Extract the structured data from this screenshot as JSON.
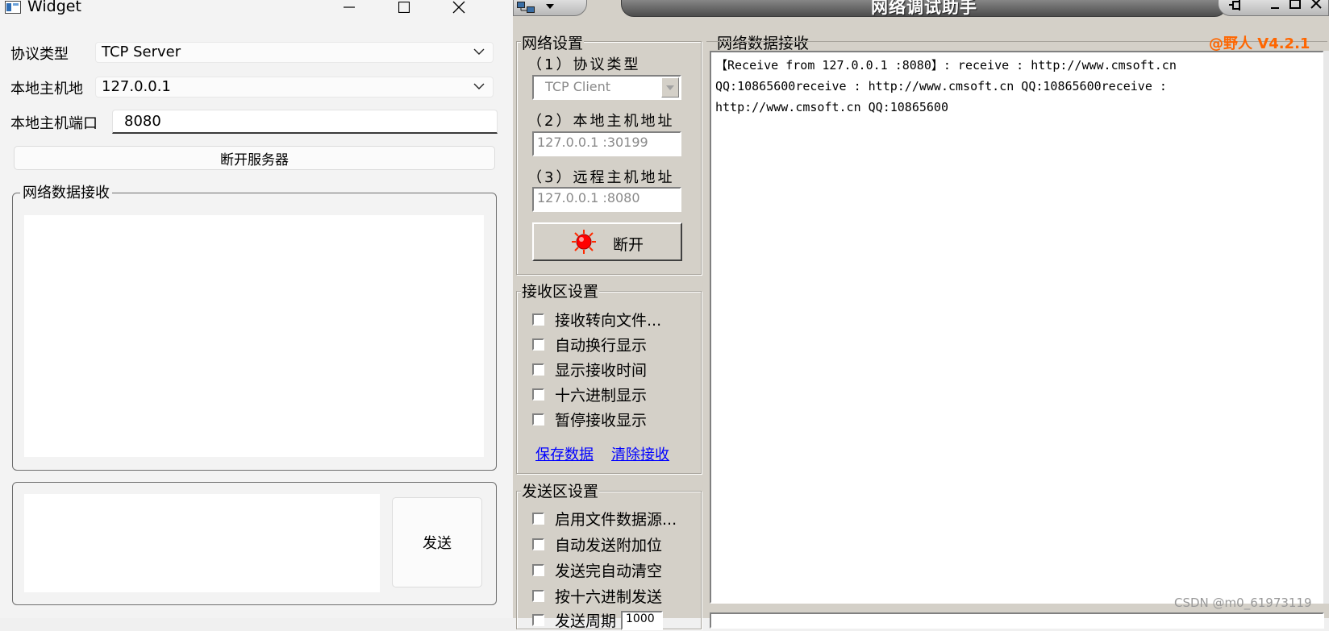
{
  "qt_window": {
    "title": "Widget",
    "protocol_label": "协议类型",
    "protocol_value": "TCP Server",
    "host_label": "本地主机地",
    "host_value": "127.0.0.1",
    "port_label": "本地主机端口",
    "port_value": "8080",
    "disconnect_label": "断开服务器",
    "recv_group_title": "网络数据接收",
    "send_label": "发送"
  },
  "netassist": {
    "title": "网络调试助手",
    "version": "@野人 V4.2.1",
    "net_settings_title": "网络设置",
    "protocol_caption": "（1）协议类型",
    "protocol_value": "TCP Client",
    "local_caption": "（2）本地主机地址",
    "local_value": "127.0.0.1 :30199",
    "remote_caption": "（3）远程主机地址",
    "remote_value": "127.0.0.1 :8080",
    "disconnect_label": "断开",
    "recv_settings_title": "接收区设置",
    "recv_options": [
      "接收转向文件...",
      "自动换行显示",
      "显示接收时间",
      "十六进制显示",
      "暂停接收显示"
    ],
    "save_link": "保存数据",
    "clear_link": "清除接收",
    "send_settings_title": "发送区设置",
    "send_options": [
      "启用文件数据源...",
      "自动发送附加位",
      "发送完自动清空",
      "按十六进制发送",
      "发送周期"
    ],
    "period_value": "1000",
    "recv_panel_title": "网络数据接收",
    "received_text": "【Receive from 127.0.0.1 :8080】: receive : http://www.cmsoft.cn\nQQ:10865600receive : http://www.cmsoft.cn QQ:10865600receive :\nhttp://www.cmsoft.cn QQ:10865600",
    "watermark": "CSDN @m0_61973119"
  }
}
